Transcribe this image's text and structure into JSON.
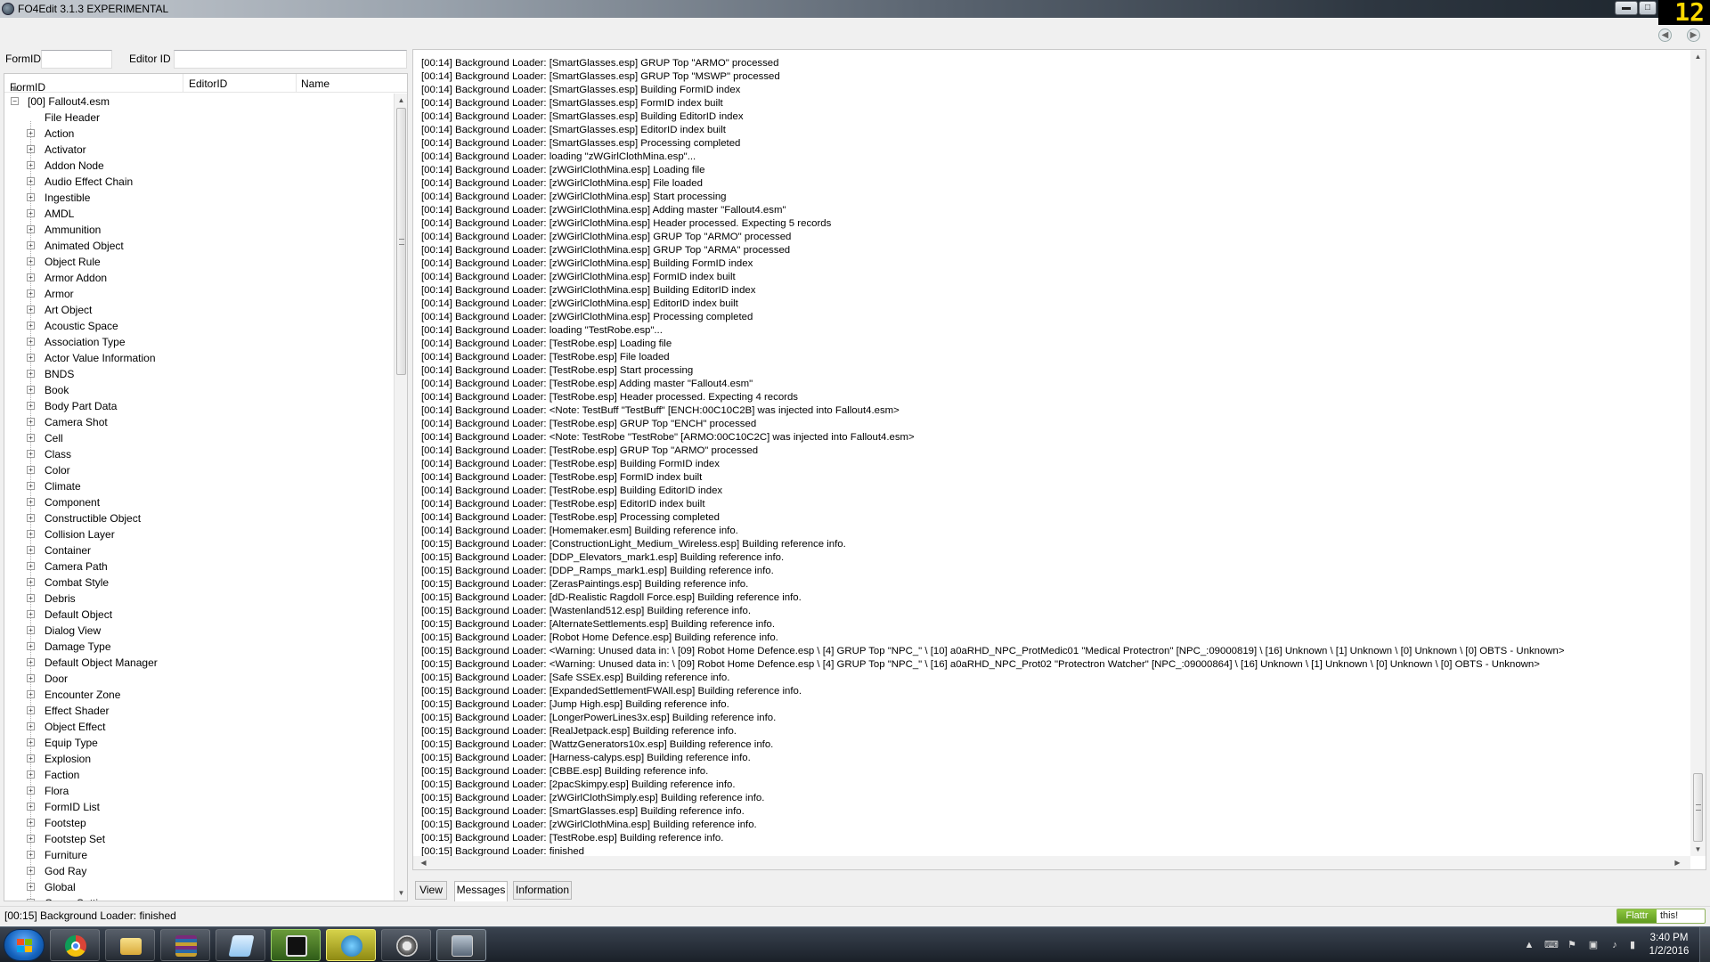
{
  "window": {
    "title": "FO4Edit 3.1.3 EXPERIMENTAL",
    "minimize_glyph": "▬",
    "maximize_glyph": "□",
    "overlay_counter": "12"
  },
  "filter": {
    "formid_label": "FormID",
    "formid_value": "",
    "editorid_label": "Editor ID",
    "editorid_value": "",
    "back_icon": "back-arrow-icon",
    "forward_icon": "forward-arrow-icon"
  },
  "tree": {
    "columns": [
      "FormID",
      "EditorID",
      "Name"
    ],
    "root": "[00] Fallout4.esm",
    "root_toggle": "−",
    "items": [
      {
        "label": "File Header",
        "expandable": false
      },
      {
        "label": "Action",
        "expandable": true
      },
      {
        "label": "Activator",
        "expandable": true
      },
      {
        "label": "Addon Node",
        "expandable": true
      },
      {
        "label": "Audio Effect Chain",
        "expandable": true
      },
      {
        "label": "Ingestible",
        "expandable": true
      },
      {
        "label": "AMDL",
        "expandable": true
      },
      {
        "label": "Ammunition",
        "expandable": true
      },
      {
        "label": "Animated Object",
        "expandable": true
      },
      {
        "label": "Object Rule",
        "expandable": true
      },
      {
        "label": "Armor Addon",
        "expandable": true
      },
      {
        "label": "Armor",
        "expandable": true
      },
      {
        "label": "Art Object",
        "expandable": true
      },
      {
        "label": "Acoustic Space",
        "expandable": true
      },
      {
        "label": "Association Type",
        "expandable": true
      },
      {
        "label": "Actor Value Information",
        "expandable": true
      },
      {
        "label": "BNDS",
        "expandable": true
      },
      {
        "label": "Book",
        "expandable": true
      },
      {
        "label": "Body Part Data",
        "expandable": true
      },
      {
        "label": "Camera Shot",
        "expandable": true
      },
      {
        "label": "Cell",
        "expandable": true
      },
      {
        "label": "Class",
        "expandable": true
      },
      {
        "label": "Color",
        "expandable": true
      },
      {
        "label": "Climate",
        "expandable": true
      },
      {
        "label": "Component",
        "expandable": true
      },
      {
        "label": "Constructible Object",
        "expandable": true
      },
      {
        "label": "Collision Layer",
        "expandable": true
      },
      {
        "label": "Container",
        "expandable": true
      },
      {
        "label": "Camera Path",
        "expandable": true
      },
      {
        "label": "Combat Style",
        "expandable": true
      },
      {
        "label": "Debris",
        "expandable": true
      },
      {
        "label": "Default Object",
        "expandable": true
      },
      {
        "label": "Dialog View",
        "expandable": true
      },
      {
        "label": "Damage Type",
        "expandable": true
      },
      {
        "label": "Default Object Manager",
        "expandable": true
      },
      {
        "label": "Door",
        "expandable": true
      },
      {
        "label": "Encounter Zone",
        "expandable": true
      },
      {
        "label": "Effect Shader",
        "expandable": true
      },
      {
        "label": "Object Effect",
        "expandable": true
      },
      {
        "label": "Equip Type",
        "expandable": true
      },
      {
        "label": "Explosion",
        "expandable": true
      },
      {
        "label": "Faction",
        "expandable": true
      },
      {
        "label": "Flora",
        "expandable": true
      },
      {
        "label": "FormID List",
        "expandable": true
      },
      {
        "label": "Footstep",
        "expandable": true
      },
      {
        "label": "Footstep Set",
        "expandable": true
      },
      {
        "label": "Furniture",
        "expandable": true
      },
      {
        "label": "God Ray",
        "expandable": true
      },
      {
        "label": "Global",
        "expandable": true
      },
      {
        "label": "Game Setting",
        "expandable": true
      }
    ]
  },
  "messages": [
    "[00:14] Background Loader: [SmartGlasses.esp] GRUP Top \"ARMO\" processed",
    "[00:14] Background Loader: [SmartGlasses.esp] GRUP Top \"MSWP\" processed",
    "[00:14] Background Loader: [SmartGlasses.esp] Building FormID index",
    "[00:14] Background Loader: [SmartGlasses.esp] FormID index built",
    "[00:14] Background Loader: [SmartGlasses.esp] Building EditorID index",
    "[00:14] Background Loader: [SmartGlasses.esp] EditorID index built",
    "[00:14] Background Loader: [SmartGlasses.esp] Processing completed",
    "[00:14] Background Loader: loading \"zWGirlClothMina.esp\"...",
    "[00:14] Background Loader: [zWGirlClothMina.esp] Loading file",
    "[00:14] Background Loader: [zWGirlClothMina.esp] File loaded",
    "[00:14] Background Loader: [zWGirlClothMina.esp] Start processing",
    "[00:14] Background Loader: [zWGirlClothMina.esp] Adding master \"Fallout4.esm\"",
    "[00:14] Background Loader: [zWGirlClothMina.esp] Header processed. Expecting 5 records",
    "[00:14] Background Loader: [zWGirlClothMina.esp] GRUP Top \"ARMO\" processed",
    "[00:14] Background Loader: [zWGirlClothMina.esp] GRUP Top \"ARMA\" processed",
    "[00:14] Background Loader: [zWGirlClothMina.esp] Building FormID index",
    "[00:14] Background Loader: [zWGirlClothMina.esp] FormID index built",
    "[00:14] Background Loader: [zWGirlClothMina.esp] Building EditorID index",
    "[00:14] Background Loader: [zWGirlClothMina.esp] EditorID index built",
    "[00:14] Background Loader: [zWGirlClothMina.esp] Processing completed",
    "[00:14] Background Loader: loading \"TestRobe.esp\"...",
    "[00:14] Background Loader: [TestRobe.esp] Loading file",
    "[00:14] Background Loader: [TestRobe.esp] File loaded",
    "[00:14] Background Loader: [TestRobe.esp] Start processing",
    "[00:14] Background Loader: [TestRobe.esp] Adding master \"Fallout4.esm\"",
    "[00:14] Background Loader: [TestRobe.esp] Header processed. Expecting 4 records",
    "[00:14] Background Loader: <Note: TestBuff \"TestBuff\" [ENCH:00C10C2B] was injected into Fallout4.esm>",
    "[00:14] Background Loader: [TestRobe.esp] GRUP Top \"ENCH\" processed",
    "[00:14] Background Loader: <Note: TestRobe \"TestRobe\" [ARMO:00C10C2C] was injected into Fallout4.esm>",
    "[00:14] Background Loader: [TestRobe.esp] GRUP Top \"ARMO\" processed",
    "[00:14] Background Loader: [TestRobe.esp] Building FormID index",
    "[00:14] Background Loader: [TestRobe.esp] FormID index built",
    "[00:14] Background Loader: [TestRobe.esp] Building EditorID index",
    "[00:14] Background Loader: [TestRobe.esp] EditorID index built",
    "[00:14] Background Loader: [TestRobe.esp] Processing completed",
    "[00:14] Background Loader: [Homemaker.esm] Building reference info.",
    "[00:15] Background Loader: [ConstructionLight_Medium_Wireless.esp] Building reference info.",
    "[00:15] Background Loader: [DDP_Elevators_mark1.esp] Building reference info.",
    "[00:15] Background Loader: [DDP_Ramps_mark1.esp] Building reference info.",
    "[00:15] Background Loader: [ZerasPaintings.esp] Building reference info.",
    "[00:15] Background Loader: [dD-Realistic Ragdoll Force.esp] Building reference info.",
    "[00:15] Background Loader: [Wastenland512.esp] Building reference info.",
    "[00:15] Background Loader: [AlternateSettlements.esp] Building reference info.",
    "[00:15] Background Loader: [Robot Home Defence.esp] Building reference info.",
    "[00:15] Background Loader: <Warning: Unused data in:  \\ [09] Robot Home Defence.esp \\ [4] GRUP Top \"NPC_\" \\ [10] a0aRHD_NPC_ProtMedic01 \"Medical Protectron\" [NPC_:09000819] \\ [16] Unknown \\ [1] Unknown \\ [0] Unknown \\ [0] OBTS - Unknown>",
    "[00:15] Background Loader: <Warning: Unused data in:  \\ [09] Robot Home Defence.esp \\ [4] GRUP Top \"NPC_\" \\ [16] a0aRHD_NPC_Prot02 \"Protectron Watcher\" [NPC_:09000864] \\ [16] Unknown \\ [1] Unknown \\ [0] Unknown \\ [0] OBTS - Unknown>",
    "[00:15] Background Loader: [Safe SSEx.esp] Building reference info.",
    "[00:15] Background Loader: [ExpandedSettlementFWAll.esp] Building reference info.",
    "[00:15] Background Loader: [Jump High.esp] Building reference info.",
    "[00:15] Background Loader: [LongerPowerLines3x.esp] Building reference info.",
    "[00:15] Background Loader: [RealJetpack.esp] Building reference info.",
    "[00:15] Background Loader: [WattzGenerators10x.esp] Building reference info.",
    "[00:15] Background Loader: [Harness-calyps.esp] Building reference info.",
    "[00:15] Background Loader: [CBBE.esp] Building reference info.",
    "[00:15] Background Loader: [2pacSkimpy.esp] Building reference info.",
    "[00:15] Background Loader: [zWGirlClothSimply.esp] Building reference info.",
    "[00:15] Background Loader: [SmartGlasses.esp] Building reference info.",
    "[00:15] Background Loader: [zWGirlClothMina.esp] Building reference info.",
    "[00:15] Background Loader: [TestRobe.esp] Building reference info.",
    "[00:15] Background Loader: finished"
  ],
  "tabs": [
    {
      "label": "View",
      "active": false
    },
    {
      "label": "Messages",
      "active": true
    },
    {
      "label": "Information",
      "active": false
    }
  ],
  "status": {
    "text": "[00:15] Background Loader: finished",
    "flattr_label": "Flattr",
    "flattr_this": "this!"
  },
  "taskbar": {
    "apps": [
      {
        "name": "chrome",
        "icon": "chrome-icon",
        "active": false
      },
      {
        "name": "explorer",
        "icon": "folder-icon",
        "active": false
      },
      {
        "name": "winrar",
        "icon": "winrar-icon",
        "active": false
      },
      {
        "name": "notepad",
        "icon": "notepad-icon",
        "active": false
      },
      {
        "name": "video",
        "icon": "film-icon",
        "active": true
      },
      {
        "name": "obs",
        "icon": "obs-icon",
        "active": false
      },
      {
        "name": "fallout",
        "icon": "vault-icon",
        "active": false
      },
      {
        "name": "fo4edit",
        "icon": "fo4edit-icon",
        "active": true
      }
    ],
    "clock_time": "3:40 PM",
    "clock_date": "1/2/2016"
  },
  "colors": {
    "taskbar": "#1f2630",
    "status_flattr": "#8dc63f",
    "overlay_counter": "#ffd800"
  }
}
